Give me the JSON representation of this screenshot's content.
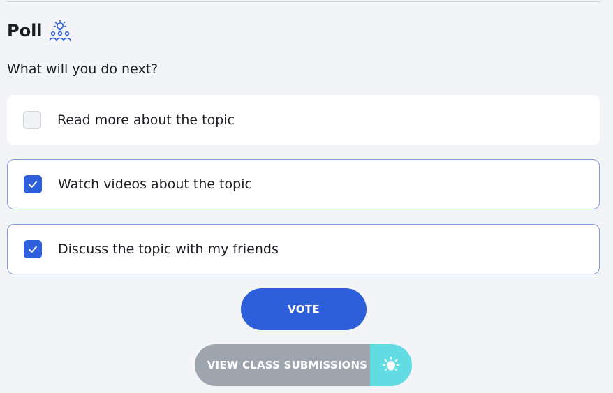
{
  "poll": {
    "title": "Poll",
    "icon": "group-idea-icon",
    "question": "What will you do next?",
    "options": [
      {
        "label": "Read more about the topic",
        "checked": false
      },
      {
        "label": "Watch videos about the topic",
        "checked": true
      },
      {
        "label": "Discuss the topic with my friends",
        "checked": true
      }
    ],
    "vote_label": "VOTE",
    "view_submissions_label": "VIEW CLASS SUBMISSIONS",
    "view_submissions_icon": "lightbulb-icon"
  },
  "colors": {
    "background": "#f3f4f8",
    "primary": "#2c5fd9",
    "checked_border": "#7f9ad6",
    "view_button": "#9fa5ae",
    "view_icon_bg": "#63dbe2"
  }
}
